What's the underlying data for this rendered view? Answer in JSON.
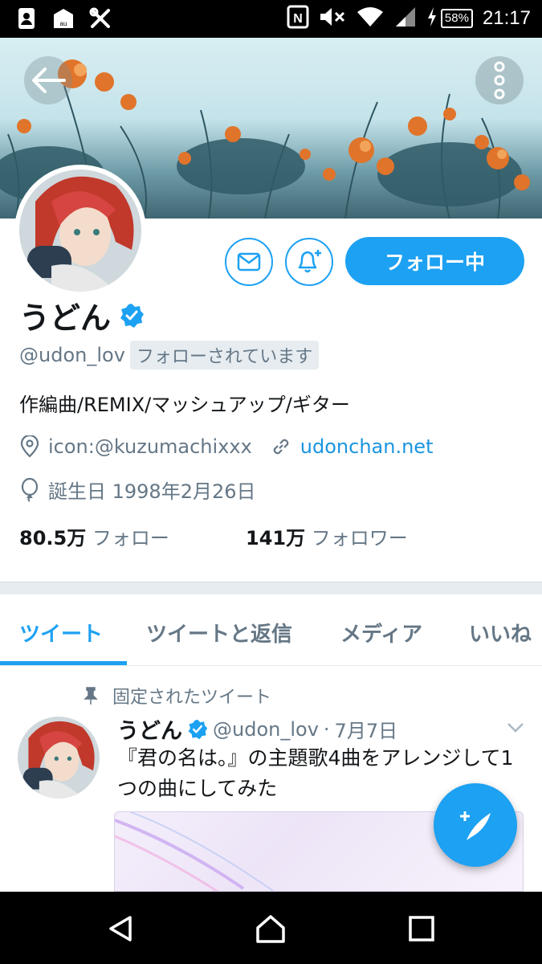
{
  "status_bar": {
    "time": "21:17",
    "battery": "58%",
    "left_icons": [
      "contact-card-icon",
      "au-mail-icon",
      "tools-icon"
    ],
    "right_icons": [
      "nfc-icon",
      "mute-icon",
      "wifi-icon",
      "signal-icon",
      "charging-icon"
    ]
  },
  "colors": {
    "accent": "#1da1f2",
    "link": "#1b95e0",
    "muted": "#657786",
    "text": "#14171a"
  },
  "profile": {
    "display_name": "うどん",
    "verified": true,
    "handle": "@udon_lov",
    "follows_you": "フォローされています",
    "bio": "作編曲/REMIX/マッシュアップ/ギター",
    "location": "icon:@kuzumachixxx",
    "website": "udonchan.net",
    "birthday": "誕生日 1998年2月26日",
    "following_count": "80.5万",
    "following_label": "フォロー",
    "followers_count": "141万",
    "followers_label": "フォロワー"
  },
  "actions": {
    "follow_label": "フォロー中"
  },
  "tabs": [
    {
      "label": "ツイート",
      "active": true
    },
    {
      "label": "ツイートと返信",
      "active": false
    },
    {
      "label": "メディア",
      "active": false
    },
    {
      "label": "いいね",
      "active": false
    }
  ],
  "pinned_tweet": {
    "pinned_label": "固定されたツイート",
    "name": "うどん",
    "handle": "@udon_lov",
    "separator": "·",
    "date": "7月7日",
    "text": "『君の名は。』の主題歌4曲をアレンジして1つの曲にしてみた"
  }
}
